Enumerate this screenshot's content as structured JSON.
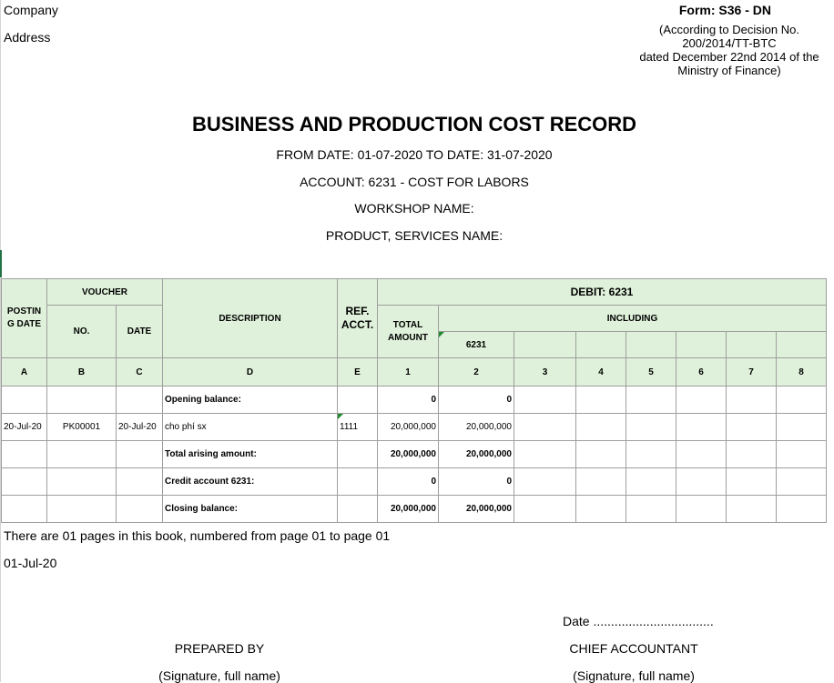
{
  "header": {
    "company": "Company",
    "address": "Address",
    "form_code": "Form: S36 - DN",
    "decision_lines": [
      "(According to Decision No.",
      "200/2014/TT-BTC",
      "dated December 22nd 2014 of the",
      "Ministry of Finance)"
    ]
  },
  "title": "BUSINESS AND PRODUCTION COST RECORD",
  "period": "FROM DATE: 01-07-2020 TO DATE: 31-07-2020",
  "account": "ACCOUNT: 6231 - COST FOR LABORS",
  "workshop": "WORKSHOP NAME:",
  "product": "PRODUCT, SERVICES NAME:",
  "table": {
    "posting_date": "POSTIN G DATE",
    "voucher": "VOUCHER",
    "voucher_no": "NO.",
    "voucher_date": "DATE",
    "description": "DESCRIPTION",
    "ref_acct": "REF. ACCT.",
    "debit": "DEBIT: 6231",
    "total_amount": "TOTAL AMOUNT",
    "including": "INCLUDING",
    "sub_account": "6231",
    "codes": [
      "A",
      "B",
      "C",
      "D",
      "E",
      "1",
      "2",
      "3",
      "4",
      "5",
      "6",
      "7",
      "8"
    ],
    "rows": [
      {
        "posting": "",
        "no": "",
        "date": "",
        "desc": "Opening balance:",
        "ref": "",
        "total": "0",
        "c6231": "0"
      },
      {
        "posting": "20-Jul-20",
        "no": "PK00001",
        "date": "20-Jul-20",
        "desc": "cho phí sx",
        "ref": "1111",
        "total": "20,000,000",
        "c6231": "20,000,000"
      },
      {
        "posting": "",
        "no": "",
        "date": "",
        "desc": "Total arising amount:",
        "ref": "",
        "total": "20,000,000",
        "c6231": "20,000,000"
      },
      {
        "posting": "",
        "no": "",
        "date": "",
        "desc": "Credit account 6231:",
        "ref": "",
        "total": "0",
        "c6231": "0"
      },
      {
        "posting": "",
        "no": "",
        "date": "",
        "desc": "Closing balance:",
        "ref": "",
        "total": "20,000,000",
        "c6231": "20,000,000"
      }
    ]
  },
  "footer": {
    "pages_note": "There are 01 pages in this book, numbered from page 01 to page 01",
    "date_printed": "01-Jul-20",
    "date_label": "Date ..................................",
    "prepared_by": "PREPARED BY",
    "chief_accountant": "CHIEF ACCOUNTANT",
    "signature_left": "(Signature, full name)",
    "signature_right": "(Signature, full name)"
  }
}
